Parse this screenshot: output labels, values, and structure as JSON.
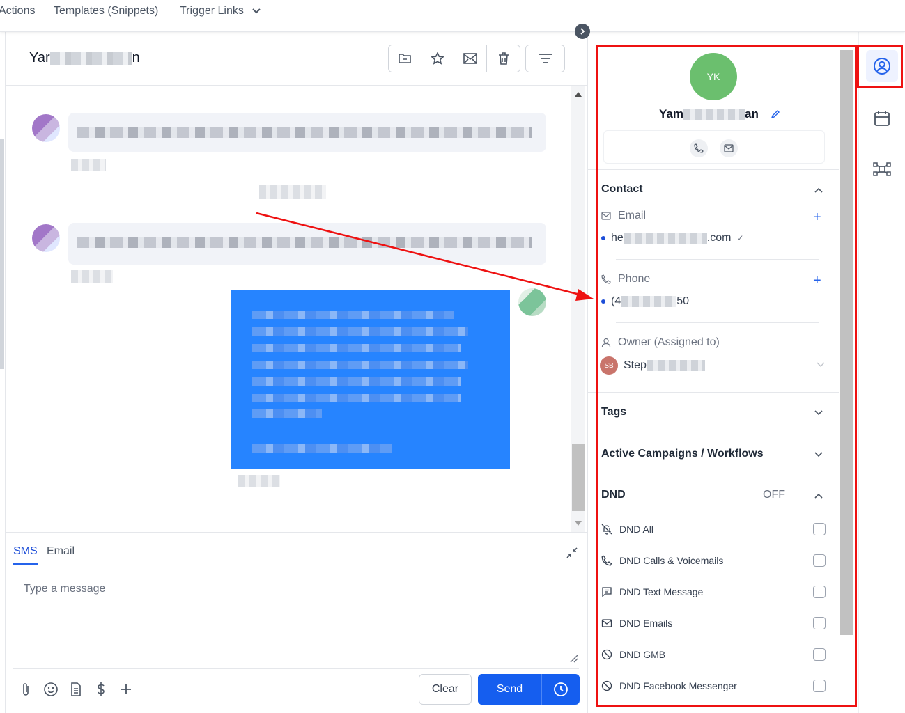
{
  "topbar": {
    "tabs": [
      "Actions",
      "Templates (Snippets)",
      "Trigger Links"
    ]
  },
  "conversation": {
    "name_visible_start": "Yar",
    "name_visible_end": "n",
    "composer": {
      "tabs": {
        "sms": "SMS",
        "email": "Email"
      },
      "placeholder": "Type a message",
      "clear_label": "Clear",
      "send_label": "Send"
    }
  },
  "contact_panel": {
    "initials": "YK",
    "name_start": "Yam",
    "name_end": "an",
    "sections": {
      "contact": "Contact",
      "tags": "Tags",
      "campaigns": "Active Campaigns / Workflows",
      "dnd": "DND"
    },
    "email": {
      "label": "Email",
      "value_start": "he",
      "value_end": ".com",
      "verified_mark": "✓"
    },
    "phone": {
      "label": "Phone",
      "value_start": "(4",
      "value_end": "50"
    },
    "owner": {
      "label": "Owner (Assigned to)",
      "initials": "SB",
      "name_start": "Step"
    },
    "dnd_status": "OFF",
    "dnd_items": [
      "DND All",
      "DND Calls & Voicemails",
      "DND Text Message",
      "DND Emails",
      "DND GMB",
      "DND Facebook Messenger"
    ]
  },
  "colors": {
    "accent": "#155eef",
    "highlight": "#e11111",
    "avatar": "#6bbf6e"
  }
}
